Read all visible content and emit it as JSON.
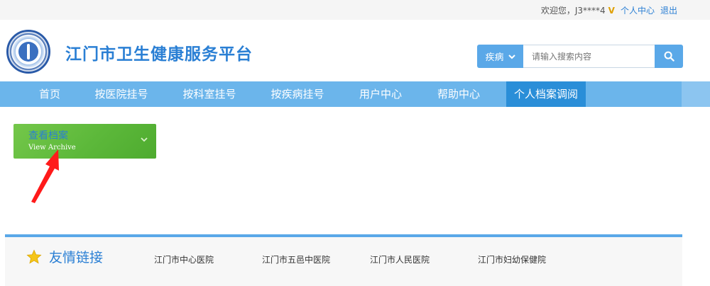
{
  "topbar": {
    "welcome": "欢迎您，J3****4",
    "v_badge": "V",
    "user_center": "个人中心",
    "logout": "退出"
  },
  "header": {
    "site_title": "江门市卫生健康服务平台",
    "logo_icon": "health-commission-emblem-icon"
  },
  "search": {
    "type_selected": "疾病",
    "placeholder": "请输入搜索内容",
    "button_icon": "search-icon"
  },
  "nav": {
    "items": [
      {
        "label": "首页"
      },
      {
        "label": "按医院挂号"
      },
      {
        "label": "按科室挂号"
      },
      {
        "label": "按疾病挂号"
      },
      {
        "label": "用户中心"
      },
      {
        "label": "帮助中心"
      },
      {
        "label": "个人档案调阅"
      }
    ],
    "active_index": 6
  },
  "archive_card": {
    "title": "查看档案",
    "subtitle": "View Archive"
  },
  "friend_links": {
    "title": "友情链接",
    "items": [
      {
        "label": "江门市中心医院"
      },
      {
        "label": "江门市五邑中医院"
      },
      {
        "label": "江门市人民医院"
      },
      {
        "label": "江门市妇幼保健院"
      }
    ]
  },
  "colors": {
    "accent": "#2a7fd4",
    "nav_bg": "#6bb5eb",
    "nav_active": "#2a8ed8",
    "card_green": "#5cb83a",
    "annotation_arrow": "#ff1a1a"
  }
}
